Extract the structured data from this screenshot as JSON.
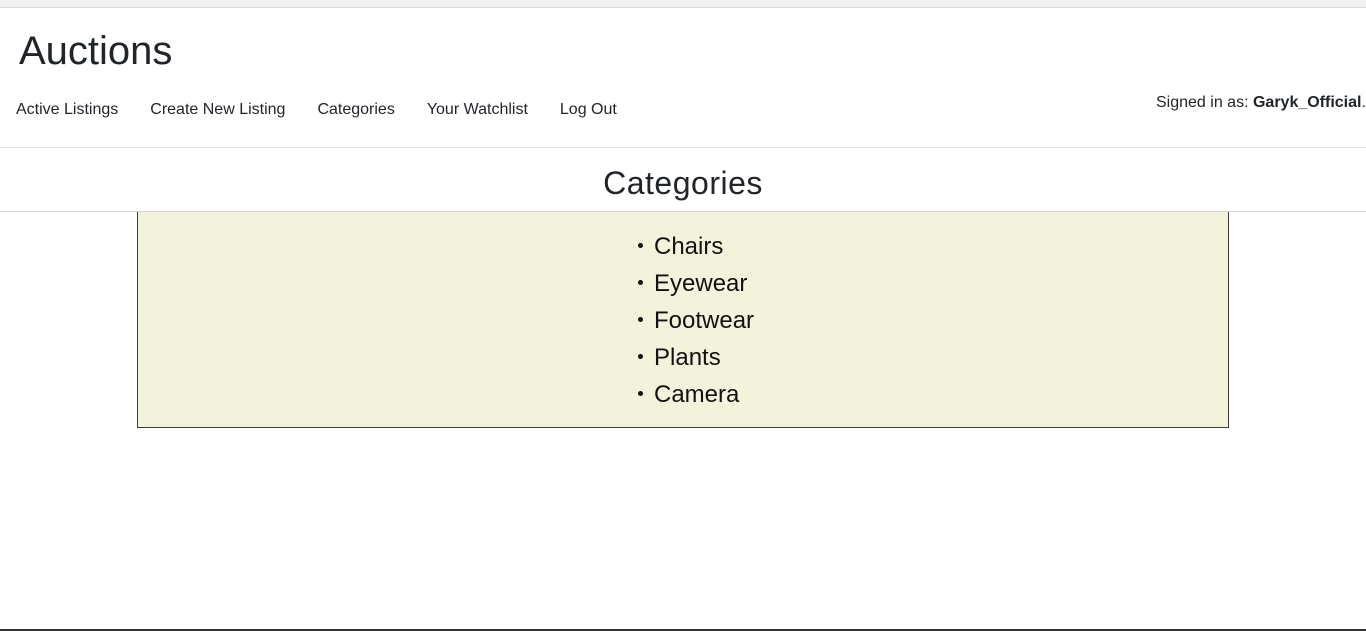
{
  "header": {
    "site_title": "Auctions",
    "nav": [
      {
        "label": "Active Listings"
      },
      {
        "label": "Create New Listing"
      },
      {
        "label": "Categories"
      },
      {
        "label": "Your Watchlist"
      },
      {
        "label": "Log Out"
      }
    ],
    "signed_in": {
      "prefix": "Signed in as:",
      "username": "Garyk_Official",
      "suffix": "."
    }
  },
  "main": {
    "heading": "Categories",
    "categories": [
      {
        "label": "Chairs"
      },
      {
        "label": "Eyewear"
      },
      {
        "label": "Footwear"
      },
      {
        "label": "Plants"
      },
      {
        "label": "Camera"
      }
    ]
  },
  "colors": {
    "category_box_bg": "#f3f3dc",
    "text": "#212529"
  }
}
